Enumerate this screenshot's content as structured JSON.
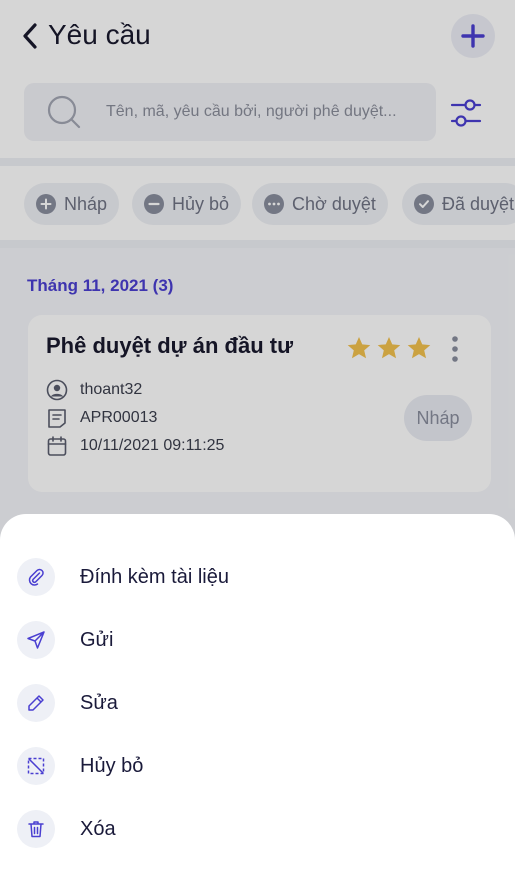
{
  "header": {
    "title": "Yêu cầu"
  },
  "search": {
    "placeholder": "Tên, mã, yêu cầu bởi, người phê duyệt..."
  },
  "filters": [
    {
      "label": "Nháp",
      "icon": "plus-circle-icon"
    },
    {
      "label": "Hủy bỏ",
      "icon": "minus-circle-icon"
    },
    {
      "label": "Chờ duyệt",
      "icon": "dots-circle-icon"
    },
    {
      "label": "Đã duyệt",
      "icon": "check-circle-icon"
    }
  ],
  "section": {
    "month_label": "Tháng 11, 2021 (3)"
  },
  "card": {
    "title": "Phê duyệt dự án đầu tư",
    "stars": 3,
    "user": "thoant32",
    "code": "APR00013",
    "datetime": "10/11/2021 09:11:25",
    "status": "Nháp"
  },
  "sheet": {
    "items": [
      {
        "label": "Đính kèm tài liệu",
        "icon": "paperclip-icon"
      },
      {
        "label": "Gửi",
        "icon": "send-icon"
      },
      {
        "label": "Sửa",
        "icon": "pencil-icon"
      },
      {
        "label": "Hủy bỏ",
        "icon": "cancel-selection-icon"
      },
      {
        "label": "Xóa",
        "icon": "trash-icon"
      }
    ]
  },
  "colors": {
    "accent": "#4a3fd1",
    "star": "#f2c14e",
    "text_dark": "#1a1a2e",
    "muted": "#8a8e9e"
  }
}
